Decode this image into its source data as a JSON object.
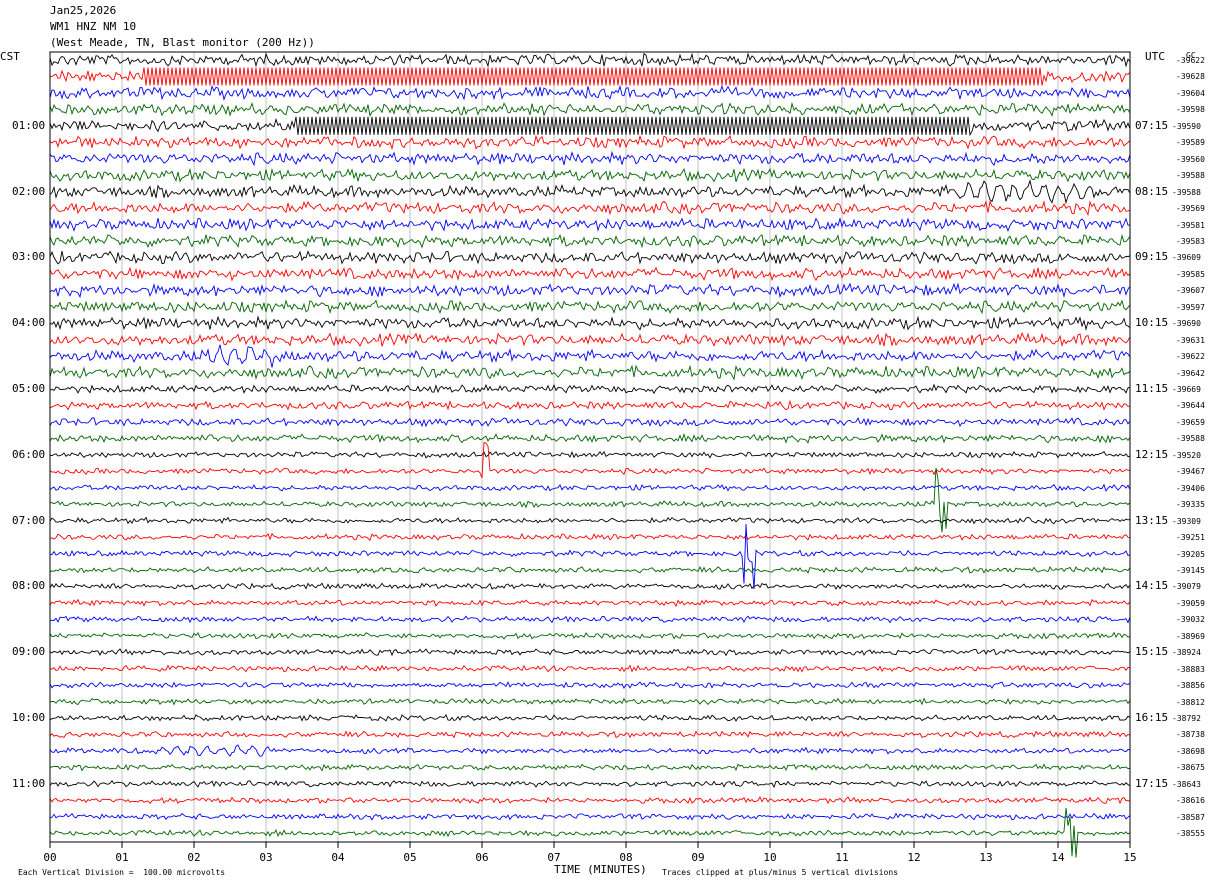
{
  "header": {
    "date": "Jan25,2026",
    "station": "WM1 HNZ NM 10",
    "location": "(West Meade, TN, Blast monitor (200 Hz))"
  },
  "left_tz": "CST",
  "right_tz": "UTC",
  "gc_label": "GC",
  "footer": {
    "scale_note": "Each Vertical Division =  100.00 microvolts",
    "xlabel": "TIME (MINUTES)",
    "clip_note": "Traces clipped at plus/minus 5 vertical divisions"
  },
  "colors": {
    "black": "#000000",
    "red": "#ff0000",
    "blue": "#0000ff",
    "green": "#006400"
  },
  "chart_data": {
    "type": "line",
    "title": "WM1 HNZ NM 10",
    "xlabel": "TIME (MINUTES)",
    "xlim": [
      0,
      15
    ],
    "x_ticks": [
      "00",
      "01",
      "02",
      "03",
      "04",
      "05",
      "06",
      "07",
      "08",
      "09",
      "10",
      "11",
      "12",
      "13",
      "14",
      "15"
    ],
    "left_hour_labels": [
      "01:00",
      "02:00",
      "03:00",
      "04:00",
      "05:00",
      "06:00",
      "07:00",
      "08:00",
      "09:00",
      "10:00",
      "11:00"
    ],
    "right_hour_labels": [
      "07:15",
      "08:15",
      "09:15",
      "10:15",
      "11:15",
      "12:15",
      "13:15",
      "14:15",
      "15:15",
      "16:15",
      "17:15"
    ],
    "trace_color_cycle": [
      "black",
      "red",
      "blue",
      "green"
    ],
    "trace_count": 48,
    "trace_offsets": [
      "-39622",
      "-39628",
      "-39604",
      "-39598",
      "-39590",
      "-39589",
      "-39560",
      "-39588",
      "-39588",
      "-39569",
      "-39581",
      "-39583",
      "-39609",
      "-39585",
      "-39607",
      "-39597",
      "-39690",
      "-39631",
      "-39622",
      "-39642",
      "-39669",
      "-39644",
      "-39659",
      "-39588",
      "-39520",
      "-39467",
      "-39406",
      "-39335",
      "-39309",
      "-39251",
      "-39205",
      "-39145",
      "-39079",
      "-39059",
      "-39032",
      "-38969",
      "-38924",
      "-38883",
      "-38856",
      "-38812",
      "-38792",
      "-38738",
      "-38698",
      "-38675",
      "-38643",
      "-38616",
      "-38587",
      "-38555"
    ],
    "events": [
      {
        "trace": 1,
        "start_min": 1.3,
        "end_min": 13.8,
        "amp": 1.0,
        "kind": "band"
      },
      {
        "trace": 4,
        "start_min": 3.4,
        "end_min": 12.8,
        "amp": 1.0,
        "kind": "band"
      },
      {
        "trace": 8,
        "start_min": 12.6,
        "end_min": 14.5,
        "amp": 0.7,
        "kind": "sine"
      },
      {
        "trace": 18,
        "start_min": 2.2,
        "end_min": 3.1,
        "amp": 0.7,
        "kind": "sine"
      },
      {
        "trace": 30,
        "start_min": 9.6,
        "end_min": 9.8,
        "amp": 1.0,
        "kind": "spike"
      },
      {
        "trace": 27,
        "start_min": 12.3,
        "end_min": 12.45,
        "amp": 1.4,
        "kind": "spike"
      },
      {
        "trace": 25,
        "start_min": 6.0,
        "end_min": 6.1,
        "amp": 0.9,
        "kind": "spike"
      },
      {
        "trace": 42,
        "start_min": 1.4,
        "end_min": 3.1,
        "amp": 0.35,
        "kind": "sine"
      },
      {
        "trace": 47,
        "start_min": 14.1,
        "end_min": 14.25,
        "amp": 0.8,
        "kind": "spike"
      }
    ]
  }
}
